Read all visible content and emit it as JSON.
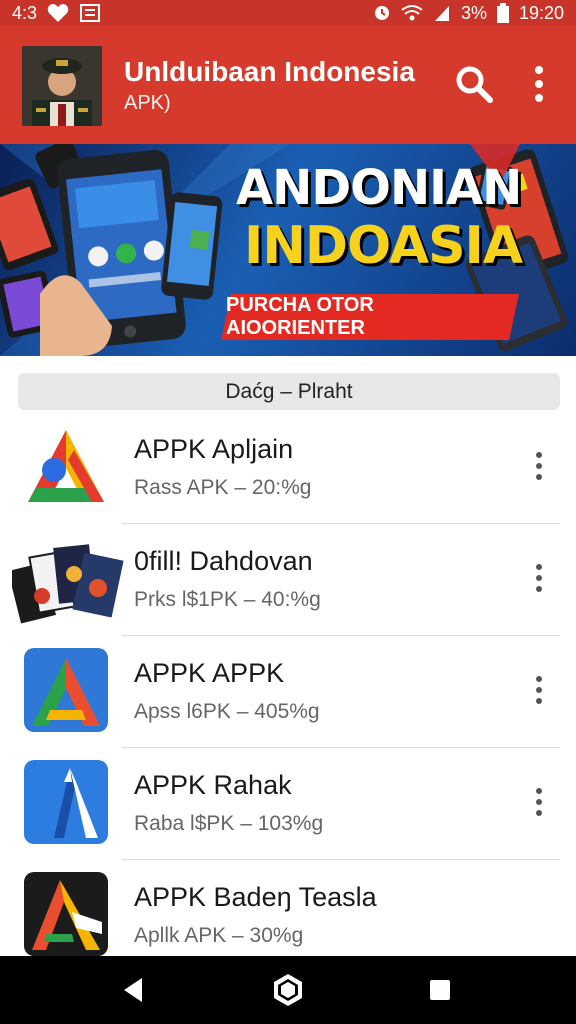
{
  "status_bar": {
    "left_text": "4:3",
    "battery": "3%",
    "time": "19:20"
  },
  "app_bar": {
    "title": "Unlduibaan Indonesia",
    "subtitle": "APK)"
  },
  "banner": {
    "line1": "ANDONIAN",
    "line2": "INDOASIA",
    "ribbon": "PURCHA OTOR AIOORIENTER"
  },
  "filter": {
    "label": "Daćg – Plraht"
  },
  "apps": [
    {
      "name": "APPK Apljain",
      "meta": "Rass APK – 20:%g"
    },
    {
      "name": "0fill! Dahdovan",
      "meta": "Prks l$1PK – 40:%g"
    },
    {
      "name": "APPK APPK",
      "meta": "Apss l6PK – 405%g"
    },
    {
      "name": "APPK Rahak",
      "meta": "Raba l$PK – 103%g"
    },
    {
      "name": "APPK Badeŋ Teasla",
      "meta": "Apllk APK – 30%g"
    }
  ],
  "colors": {
    "app_bar": "#d63a2c",
    "status_bar": "#c9342a",
    "banner_yellow": "#f6d21c"
  }
}
